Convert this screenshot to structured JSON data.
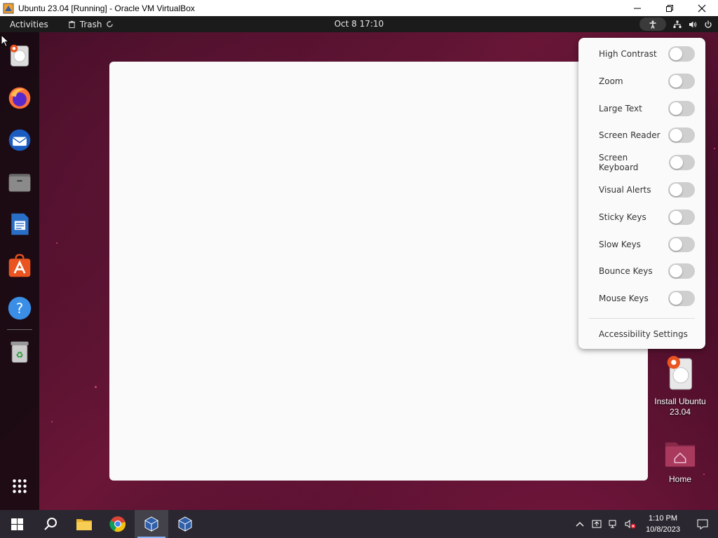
{
  "host_window": {
    "title": "Ubuntu 23.04 [Running] - Oracle VM VirtualBox"
  },
  "top_bar": {
    "activities": "Activities",
    "app_name": "Trash",
    "clock": "Oct 8  17:10"
  },
  "dock": {
    "items": [
      "installer-icon",
      "firefox-icon",
      "thunderbird-icon",
      "files-icon",
      "libreoffice-writer-icon",
      "app-center-icon",
      "help-icon",
      "trash-icon",
      "show-apps-icon"
    ]
  },
  "accessibility_menu": {
    "items": [
      {
        "label": "High Contrast",
        "enabled": false
      },
      {
        "label": "Zoom",
        "enabled": false
      },
      {
        "label": "Large Text",
        "enabled": false
      },
      {
        "label": "Screen Reader",
        "enabled": false
      },
      {
        "label": "Screen Keyboard",
        "enabled": false
      },
      {
        "label": "Visual Alerts",
        "enabled": false
      },
      {
        "label": "Sticky Keys",
        "enabled": false
      },
      {
        "label": "Slow Keys",
        "enabled": false
      },
      {
        "label": "Bounce Keys",
        "enabled": false
      },
      {
        "label": "Mouse Keys",
        "enabled": false
      }
    ],
    "settings_label": "Accessibility Settings"
  },
  "desktop_icons": {
    "install": {
      "line1": "Install Ubuntu",
      "line2": "23.04"
    },
    "home": {
      "label": "Home"
    }
  },
  "taskbar": {
    "time": "1:10 PM",
    "date": "10/8/2023"
  },
  "colors": {
    "ubuntu_orange": "#e95420",
    "topbar": "#1b1b1b",
    "taskbar": "#2a2730"
  }
}
